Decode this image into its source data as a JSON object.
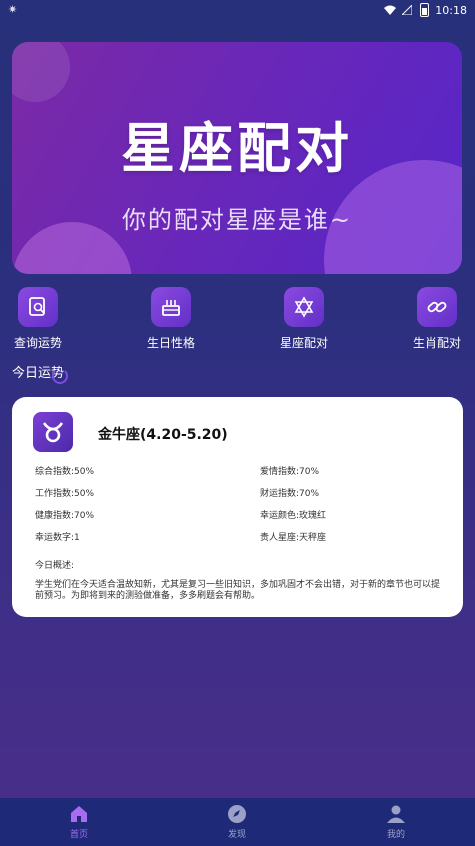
{
  "status_bar": {
    "left_icon": "notification-dot",
    "time": "10:18"
  },
  "banner": {
    "title": "星座配对",
    "subtitle": "你的配对星座是谁~"
  },
  "quick_nav": [
    {
      "label": "查询运势",
      "icon": "search-document-icon"
    },
    {
      "label": "生日性格",
      "icon": "birthday-cake-icon"
    },
    {
      "label": "星座配对",
      "icon": "star-of-david-icon"
    },
    {
      "label": "生肖配对",
      "icon": "link-icon"
    }
  ],
  "section": {
    "title": "今日运势"
  },
  "fortune_card": {
    "sign_name": "金牛座(4.20-5.20)",
    "stats_left": [
      "综合指数:50%",
      "工作指数:50%",
      "健康指数:70%",
      "幸运数字:1"
    ],
    "stats_right": [
      "爱情指数:70%",
      "财运指数:70%",
      "幸运颜色:玫瑰红",
      "贵人星座:天秤座"
    ],
    "summary_title": "今日概述:",
    "summary_text": "学生党们在今天适合温故知新，尤其是复习一些旧知识，多加巩固才不会出错，对于新的章节也可以提前预习。为即将到来的测验做准备，多多刷题会有帮助。"
  },
  "bottom_nav": [
    {
      "label": "首页",
      "icon": "home-icon",
      "active": true
    },
    {
      "label": "发现",
      "icon": "compass-icon",
      "active": false
    },
    {
      "label": "我的",
      "icon": "user-icon",
      "active": false
    }
  ],
  "colors": {
    "accent": "#a86cf0",
    "nav_bg": "#1e2a78",
    "card_bg": "#ffffff"
  }
}
